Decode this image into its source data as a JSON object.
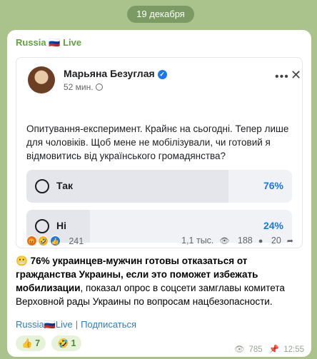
{
  "date_pill": "19 декабря",
  "channel": {
    "name": "Russia",
    "flag": "🇷🇺",
    "suffix": "Live"
  },
  "post": {
    "author": "Марьяна Безуглая",
    "verified_icon": "✓",
    "time": "52 мин.",
    "text": "Опитування-експеримент. Крайнє на сьогодні. Тепер лише для чоловіків. Щоб мене не мобілізували, чи готовий я відмовитись від українського громадянства?",
    "poll": [
      {
        "label": "Так",
        "percent_text": "76%",
        "percent": 76
      },
      {
        "label": "Ні",
        "percent_text": "24%",
        "percent": 24
      }
    ],
    "reactions": {
      "emojis": [
        "😡",
        "🤣",
        "👍"
      ],
      "count": "241"
    },
    "stats": {
      "views": "1,1 тыс.",
      "comments": "188",
      "shares": "20"
    }
  },
  "caption": {
    "emoji": "😬",
    "bold": "76% украинцев-мужчин готовы отказаться от гражданства Украины, если это поможет избежать мобилизации",
    "rest": ", показал опрос в соцсети замглавы комитета Верховной рады Украины по вопросам нацбезопасности."
  },
  "footer": {
    "channel_link": "Russia🇷🇺Live",
    "subscribe": "Подписаться"
  },
  "chips": [
    {
      "emoji": "👍",
      "count": "7"
    },
    {
      "emoji": "🤣",
      "count": "1"
    }
  ],
  "message_meta": {
    "views": "785",
    "time": "12:55"
  },
  "colors": {
    "accent_green": "#5fa53a",
    "fb_blue": "#1877f2",
    "link_blue": "#2e7cc8"
  }
}
